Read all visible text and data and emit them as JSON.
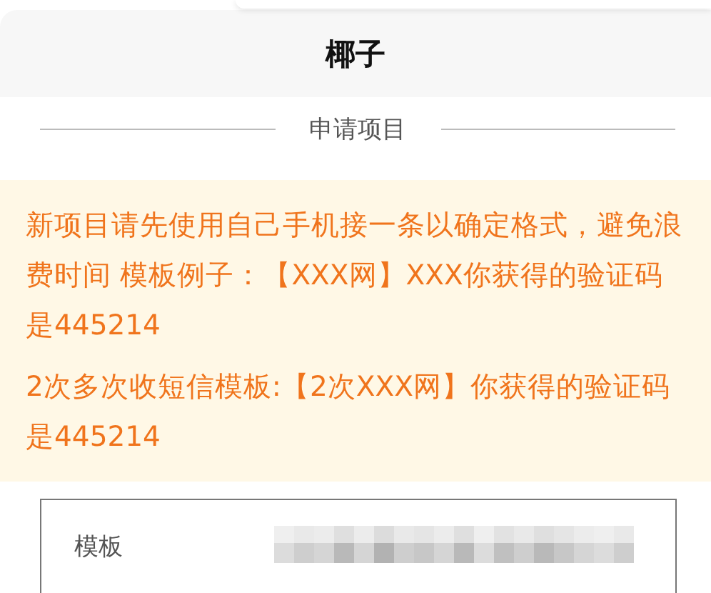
{
  "header": {
    "title": "椰子"
  },
  "section": {
    "title": "申请项目"
  },
  "notice": {
    "paragraphs": [
      "新项目请先使用自己手机接一条以确定格式，避免浪费时间 模板例子：【XXX网】XXX你获得的验证码是445214",
      "2次多次收短信模板:【2次XXX网】你获得的验证码是445214"
    ]
  },
  "form": {
    "rows": [
      {
        "label": "模板",
        "kind": "redacted"
      }
    ]
  }
}
